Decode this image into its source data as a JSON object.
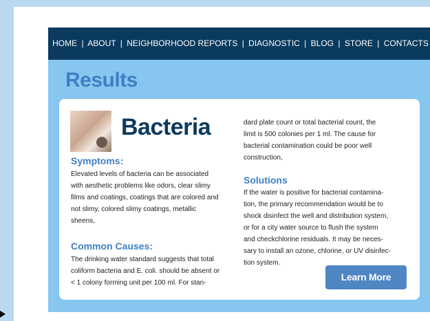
{
  "nav": {
    "items": [
      "HOME",
      "ABOUT",
      "NEIGHBORHOOD REPORTS",
      "DIAGNOSTIC",
      "BLOG",
      "STORE",
      "CONTACTS"
    ],
    "separator": "|"
  },
  "page_title": "Results",
  "card": {
    "title": "Bacteria",
    "image_icon": "bathroom-stain-photo",
    "symptoms_heading": "Symptoms:",
    "symptoms_lines": [
      "Elevated levels of bacteria can be associated",
      "with aesthetic problems like odors, clear slimy",
      "films and coatings, coatings that are colored and",
      "not slimy, colored slimy coatings, metallic",
      "sheens,"
    ],
    "causes_heading": "Common Causes:",
    "causes_lines": [
      "The drinking water standard suggests that total",
      "coliform bacteria and E. coli. should be absent or",
      "< 1 colony forming unit per 100 ml.  For stan-"
    ],
    "causes_cont_lines": [
      "dard plate count or total bacterial count, the",
      "limit is 500 colonies per 1 ml. The cause for",
      "bacterial contamination could be poor well",
      "construction,"
    ],
    "solutions_heading": "Solutions",
    "solutions_lines": [
      "If the water is positive for bacterial contamina-",
      "tion, the primary recommendation would be to",
      "shock disinfect the well and distribution system,",
      "or for a city water source to flush the system",
      "and checkchlorine residuals. It may be neces-",
      "sary to install an ozone, chlorine, or UV disinfec-",
      "tion system."
    ],
    "learn_more_label": "Learn More"
  },
  "colors": {
    "nav_bg": "#0a3b5e",
    "panel_bg": "#87c6ef",
    "accent": "#3f7fc4",
    "button_bg": "#4f86c4"
  }
}
